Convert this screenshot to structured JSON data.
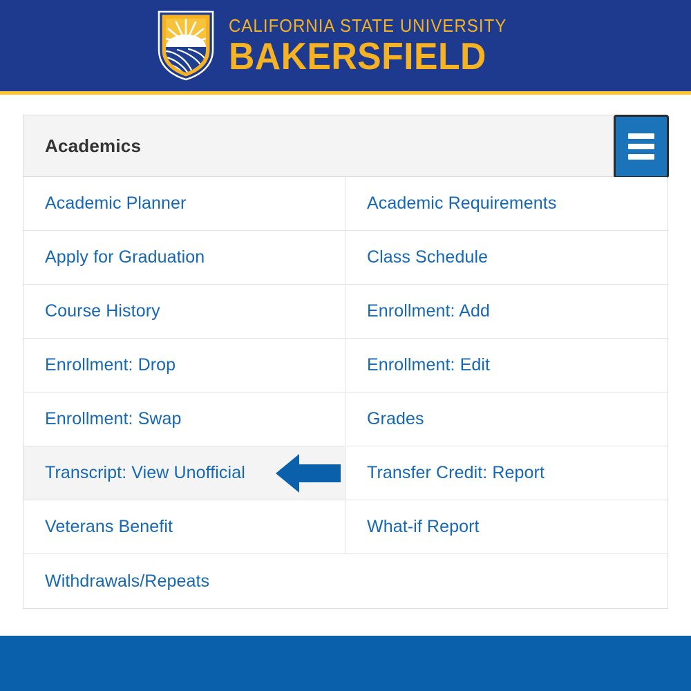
{
  "banner": {
    "university_line": "CALIFORNIA STATE UNIVERSITY",
    "campus_line": "BAKERSFIELD",
    "shield_icon": "csub-shield-logo",
    "background_color": "#1e3a8f",
    "accent_rule_color": "#ffc629",
    "wordmark_color": "#f5b223"
  },
  "panel": {
    "title": "Academics",
    "menu_button": {
      "icon": "hamburger-icon",
      "background_color": "#1b74ba",
      "border_color": "#2b2b2b"
    },
    "header_background": "#f4f4f4",
    "link_color": "#1668b3"
  },
  "links": [
    {
      "label": "Academic Planner",
      "column": "left",
      "highlighted": false,
      "arrow": false
    },
    {
      "label": "Academic Requirements",
      "column": "right",
      "highlighted": false,
      "arrow": false
    },
    {
      "label": "Apply for Graduation",
      "column": "left",
      "highlighted": false,
      "arrow": false
    },
    {
      "label": "Class Schedule",
      "column": "right",
      "highlighted": false,
      "arrow": false
    },
    {
      "label": "Course History",
      "column": "left",
      "highlighted": false,
      "arrow": false
    },
    {
      "label": "Enrollment: Add",
      "column": "right",
      "highlighted": false,
      "arrow": false
    },
    {
      "label": "Enrollment: Drop",
      "column": "left",
      "highlighted": false,
      "arrow": false
    },
    {
      "label": "Enrollment: Edit",
      "column": "right",
      "highlighted": false,
      "arrow": false
    },
    {
      "label": "Enrollment: Swap",
      "column": "left",
      "highlighted": false,
      "arrow": false
    },
    {
      "label": "Grades",
      "column": "right",
      "highlighted": false,
      "arrow": false
    },
    {
      "label": "Transcript: View Unofficial",
      "column": "left",
      "highlighted": true,
      "arrow": true
    },
    {
      "label": "Transfer Credit: Report",
      "column": "right",
      "highlighted": false,
      "arrow": false
    },
    {
      "label": "Veterans Benefit",
      "column": "left",
      "highlighted": false,
      "arrow": false
    },
    {
      "label": "What-if Report",
      "column": "right",
      "highlighted": false,
      "arrow": false
    },
    {
      "label": "Withdrawals/Repeats",
      "column": "full",
      "highlighted": false,
      "arrow": false
    }
  ],
  "annotation": {
    "arrow_icon": "left-pointing-arrow",
    "arrow_color": "#0a60ab",
    "points_at": "Transcript: View Unofficial"
  },
  "footer": {
    "background_color": "#0a60ab"
  }
}
